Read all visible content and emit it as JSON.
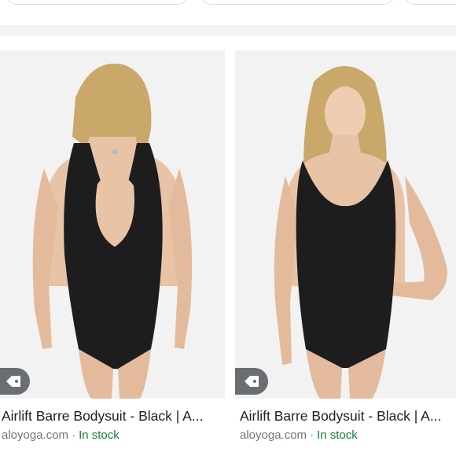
{
  "results": [
    {
      "title": "Airlift Barre Bodysuit - Black | A...",
      "source": "aloyoga.com",
      "separator": "·",
      "availability": "In stock",
      "image_alt": "Back view of black racerback bodysuit"
    },
    {
      "title": "Airlift Barre Bodysuit - Black | A...",
      "source": "aloyoga.com",
      "separator": "·",
      "availability": "In stock",
      "image_alt": "Front view of black scoop-neck bodysuit"
    }
  ],
  "icons": {
    "tag": "tag-icon"
  },
  "colors": {
    "availability": "#188038",
    "source": "#70757a",
    "title": "#202124",
    "tag_bg": "#5f6368"
  }
}
